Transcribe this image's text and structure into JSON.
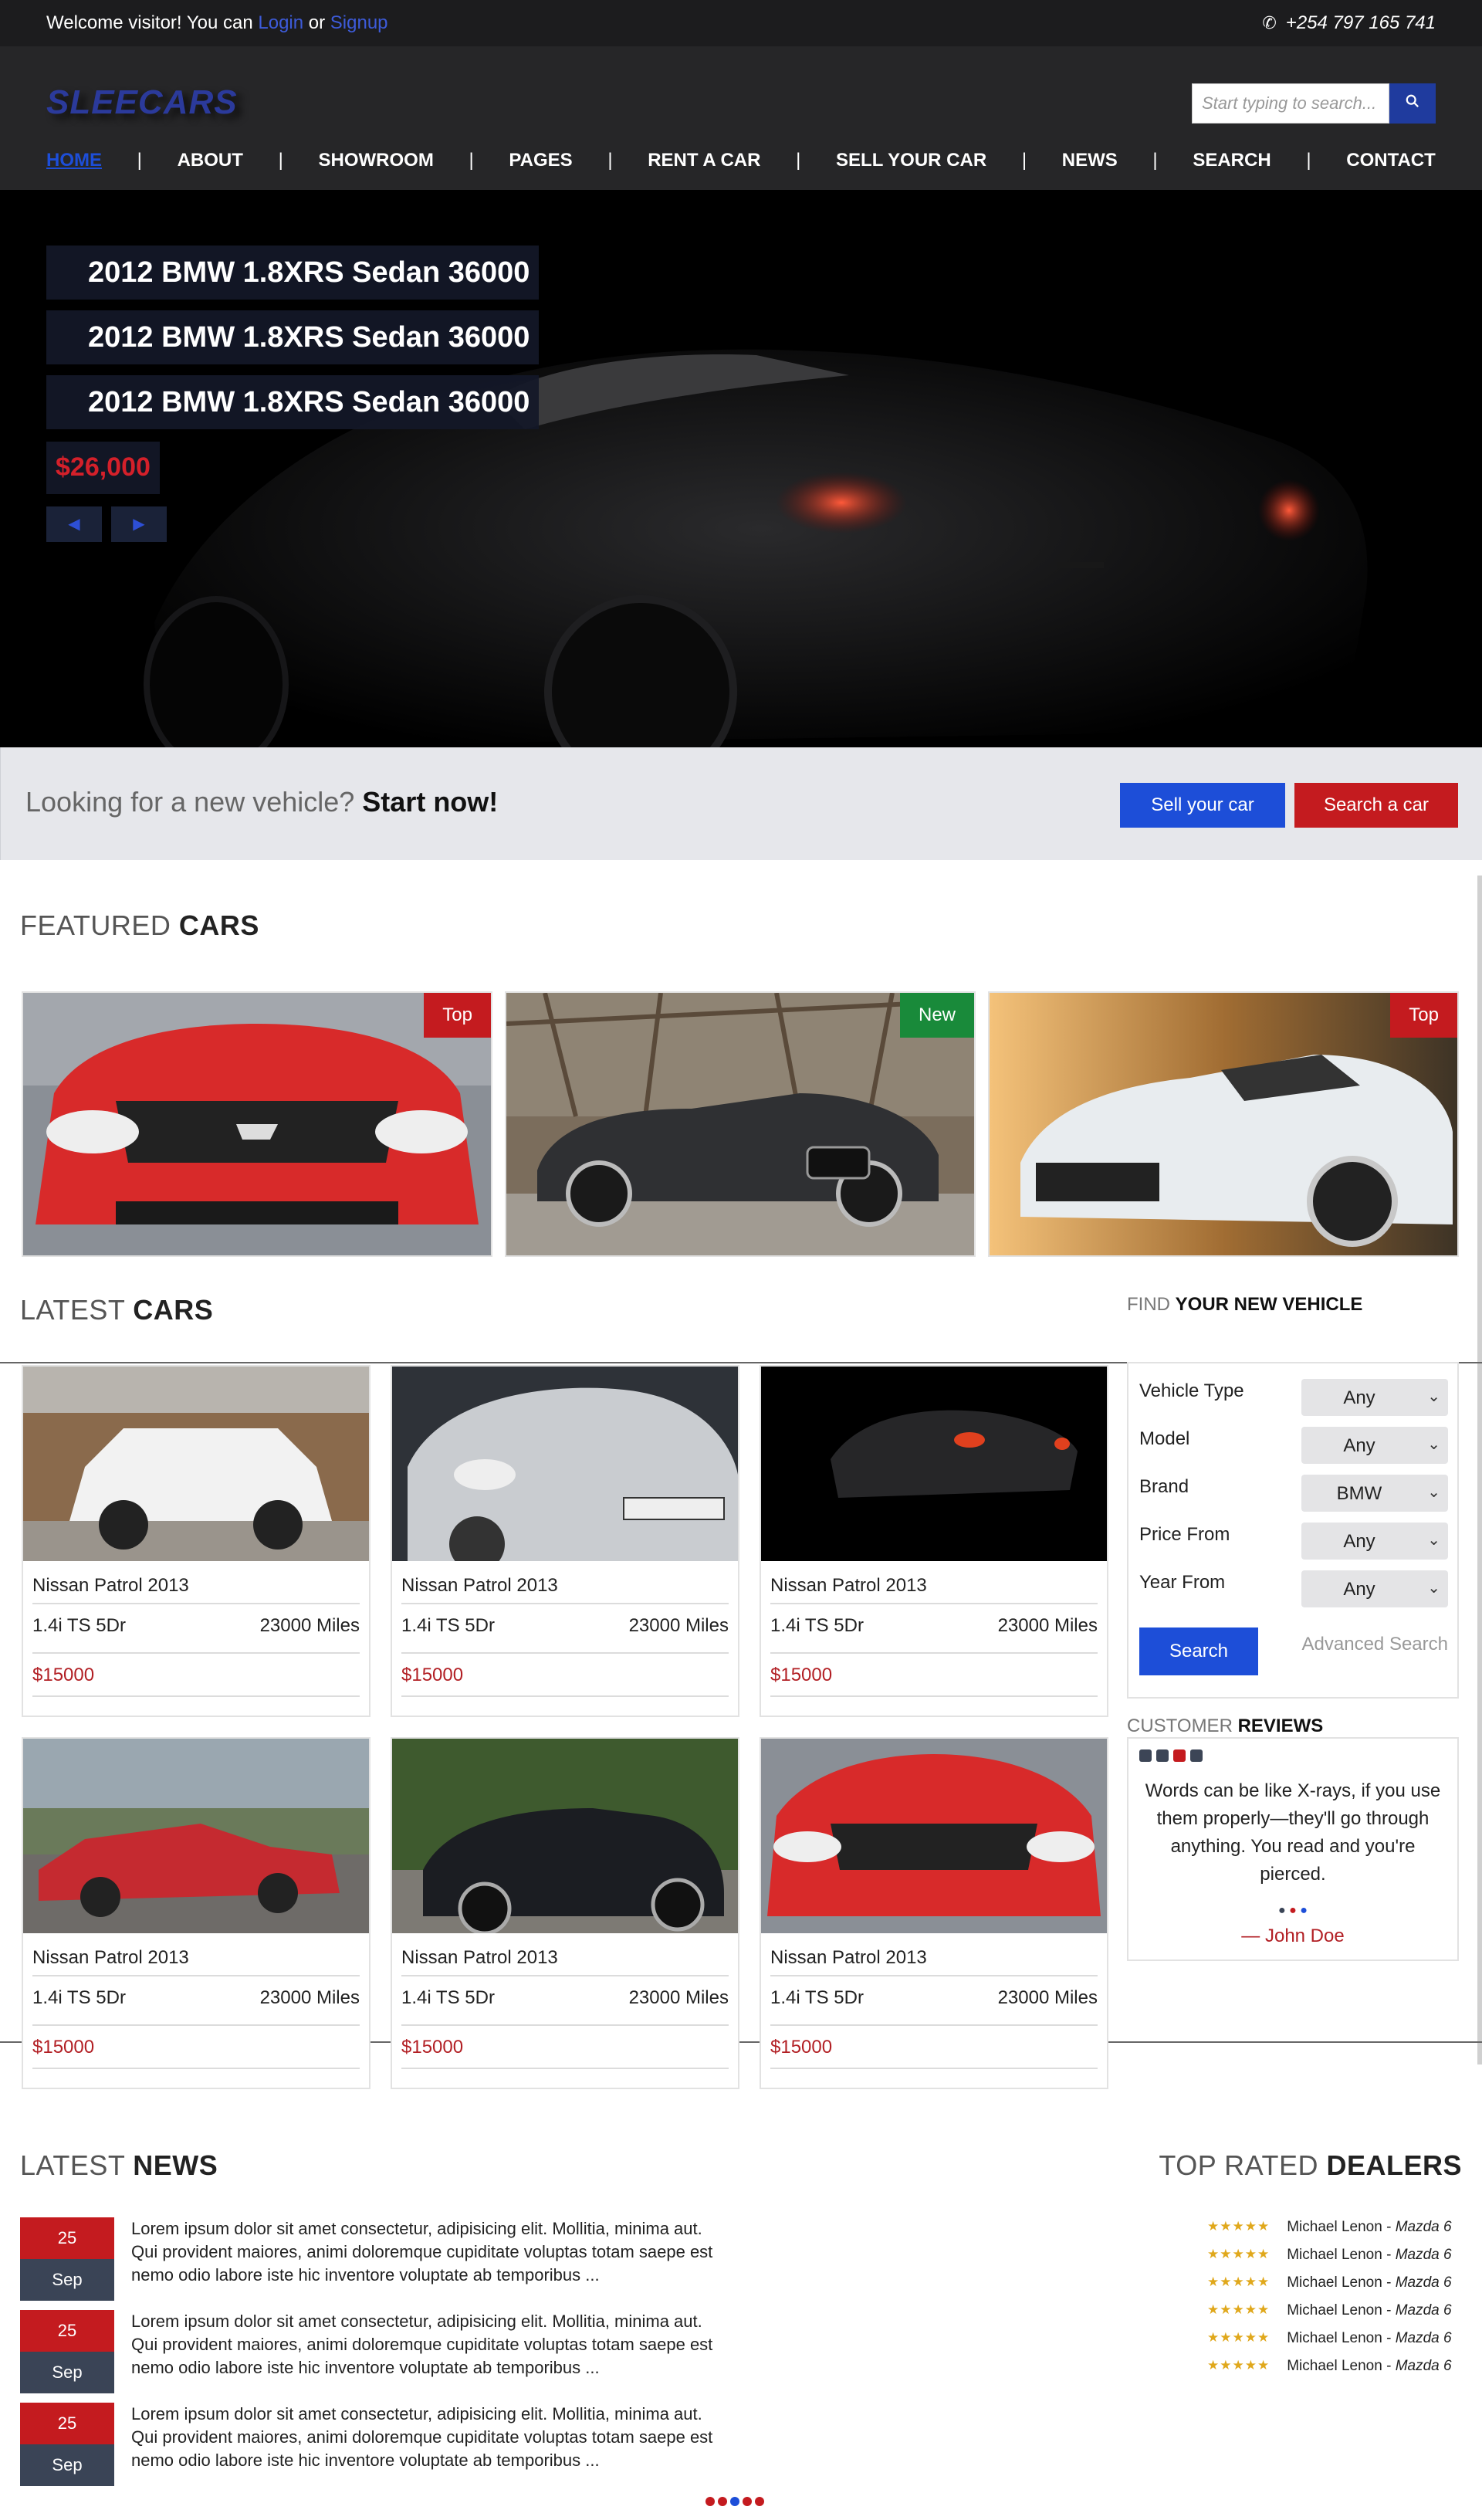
{
  "topbar": {
    "welcome_prefix": "Welcome visitor! You can",
    "login": "Login",
    "or": "or",
    "signup": "Signup",
    "phone": "+254 797 165 741"
  },
  "header": {
    "logo": "SLEECARS",
    "search_placeholder": "Start typing to search..."
  },
  "nav": [
    "HOME",
    "ABOUT",
    "SHOWROOM",
    "PAGES",
    "RENT A CAR",
    "SELL YOUR CAR",
    "NEWS",
    "SEARCH",
    "CONTACT"
  ],
  "hero": {
    "titles": [
      "2012 BMW 1.8XRS Sedan 36000",
      "2012 BMW 1.8XRS Sedan 36000",
      "2012 BMW 1.8XRS Sedan 36000"
    ],
    "price": "$26,000"
  },
  "cta": {
    "lead": "Looking for a new vehicle?",
    "strong": "Start now!",
    "sell_btn": "Sell your car",
    "search_btn": "Search a car"
  },
  "featured": {
    "head_light": "FEATURED",
    "head_bold": "CARS",
    "items": [
      {
        "badge": "Top"
      },
      {
        "badge": "New"
      },
      {
        "badge": "Top"
      }
    ]
  },
  "latest": {
    "head_light": "LATEST",
    "head_bold": "CARS",
    "cars": [
      {
        "name": "Nissan Patrol 2013",
        "spec": "1.4i TS 5Dr",
        "miles": "23000 Miles",
        "price": "$15000"
      },
      {
        "name": "Nissan Patrol 2013",
        "spec": "1.4i TS 5Dr",
        "miles": "23000 Miles",
        "price": "$15000"
      },
      {
        "name": "Nissan Patrol 2013",
        "spec": "1.4i TS 5Dr",
        "miles": "23000 Miles",
        "price": "$15000"
      },
      {
        "name": "Nissan Patrol 2013",
        "spec": "1.4i TS 5Dr",
        "miles": "23000 Miles",
        "price": "$15000"
      },
      {
        "name": "Nissan Patrol 2013",
        "spec": "1.4i TS 5Dr",
        "miles": "23000 Miles",
        "price": "$15000"
      },
      {
        "name": "Nissan Patrol 2013",
        "spec": "1.4i TS 5Dr",
        "miles": "23000 Miles",
        "price": "$15000"
      }
    ]
  },
  "finder": {
    "head_light": "FIND",
    "head_bold": "YOUR NEW VEHICLE",
    "fields": [
      {
        "label": "Vehicle Type",
        "value": "Any"
      },
      {
        "label": "Model",
        "value": "Any"
      },
      {
        "label": "Brand",
        "value": "BMW"
      },
      {
        "label": "Price From",
        "value": "Any"
      },
      {
        "label": "Year From",
        "value": "Any"
      }
    ],
    "search_btn": "Search",
    "advanced": "Advanced Search"
  },
  "reviews": {
    "head_light": "CUSTOMER",
    "head_bold": "REVIEWS",
    "quote": "Words can be like X-rays, if you use them properly—they'll go through anything. You read and you're pierced.",
    "author": "— John Doe"
  },
  "news": {
    "head_light": "LATEST",
    "head_bold": "NEWS",
    "items": [
      {
        "day": "25",
        "month": "Sep",
        "text": "Lorem ipsum dolor sit amet consectetur, adipisicing elit. Mollitia, minima aut. Qui provident maiores, animi doloremque cupiditate voluptas totam saepe est nemo odio labore iste hic inventore voluptate ab temporibus ..."
      },
      {
        "day": "25",
        "month": "Sep",
        "text": "Lorem ipsum dolor sit amet consectetur, adipisicing elit. Mollitia, minima aut. Qui provident maiores, animi doloremque cupiditate voluptas totam saepe est nemo odio labore iste hic inventore voluptate ab temporibus ..."
      },
      {
        "day": "25",
        "month": "Sep",
        "text": "Lorem ipsum dolor sit amet consectetur, adipisicing elit. Mollitia, minima aut. Qui provident maiores, animi doloremque cupiditate voluptas totam saepe est nemo odio labore iste hic inventore voluptate ab temporibus ..."
      }
    ]
  },
  "dealers": {
    "head_light": "TOP RATED",
    "head_bold": "DEALERS",
    "stars": "★★★★★",
    "rating": 5,
    "items": [
      {
        "name": "Michael Lenon -",
        "car": "Mazda 6"
      },
      {
        "name": "Michael Lenon -",
        "car": "Mazda 6"
      },
      {
        "name": "Michael Lenon -",
        "car": "Mazda 6"
      },
      {
        "name": "Michael Lenon -",
        "car": "Mazda 6"
      },
      {
        "name": "Michael Lenon -",
        "car": "Mazda 6"
      },
      {
        "name": "Michael Lenon -",
        "car": "Mazda 6"
      }
    ]
  },
  "colors": {
    "brand_blue": "#1d4ed8",
    "brand_red": "#c41b1f",
    "dark_bar": "#1c1c1e",
    "header_bg": "#262628",
    "badge_green": "#198a3a"
  },
  "icons": {
    "phone": "phone-icon",
    "search": "search-icon",
    "prev": "caret-left-icon",
    "next": "caret-right-icon",
    "select": "chevron-down-icon",
    "star": "star-icon"
  }
}
